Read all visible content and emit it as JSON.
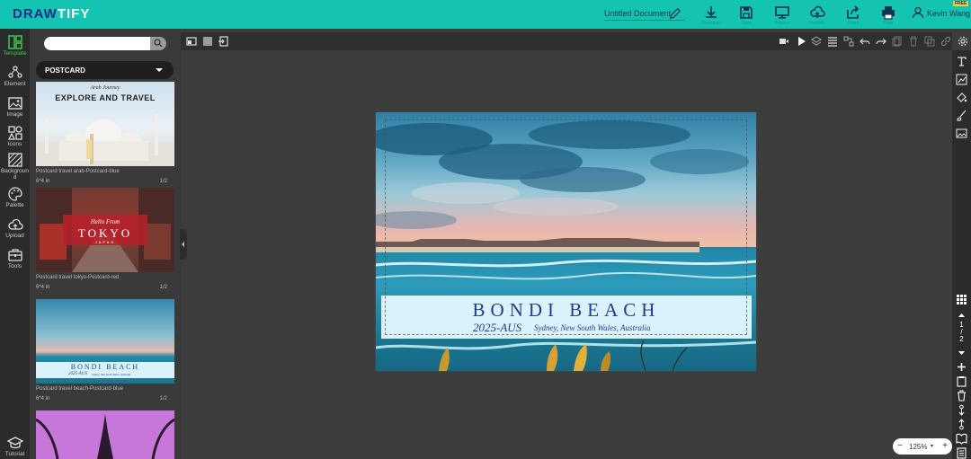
{
  "app": {
    "logo_main": "DRAW",
    "logo_accent": "TIFY",
    "document_title": "Untitled Document",
    "user_name": "Kevin Wang",
    "badge": "FREE"
  },
  "topbar": {
    "buttons": [
      {
        "name": "download",
        "label": "Download"
      },
      {
        "name": "save",
        "label": "Save"
      },
      {
        "name": "present",
        "label": "Present"
      },
      {
        "name": "publish",
        "label": "Publish"
      },
      {
        "name": "share",
        "label": "Share"
      },
      {
        "name": "print",
        "label": "Print"
      }
    ]
  },
  "rail": {
    "items": [
      {
        "name": "template",
        "label": "Template",
        "icon": "template-icon"
      },
      {
        "name": "element",
        "label": "Element",
        "icon": "element-icon"
      },
      {
        "name": "image",
        "label": "Image",
        "icon": "image-icon"
      },
      {
        "name": "icons",
        "label": "Icons",
        "icon": "shapes-icon"
      },
      {
        "name": "background",
        "label": "Backgroun d",
        "icon": "background-icon"
      },
      {
        "name": "palette",
        "label": "Palette",
        "icon": "palette-icon"
      },
      {
        "name": "upload",
        "label": "Upload",
        "icon": "cloud-upload-icon"
      },
      {
        "name": "tools",
        "label": "Tools",
        "icon": "toolbox-icon"
      },
      {
        "name": "tutorial",
        "label": "Tutorial",
        "icon": "graduation-cap-icon"
      }
    ]
  },
  "panel": {
    "search_placeholder": "",
    "category": "POSTCARD",
    "templates": [
      {
        "name": "Postcard travel arab-Postcard-blue",
        "size": "6*4 in",
        "pages": "1/2",
        "text1": "Arab Journey",
        "text2": "EXPLORE AND TRAVEL"
      },
      {
        "name": "Postcard travel tokyo-Postcard-red",
        "size": "6*4 in",
        "pages": "1/2",
        "text1": "Hello From",
        "text2": "TOKYO",
        "text3": "JAPAN"
      },
      {
        "name": "Postcard travel beach-Postcard-blue",
        "size": "6*4 in",
        "pages": "1/2",
        "text1": "BONDI BEACH",
        "text2": "2025-AUS",
        "text3": "Sydney, New South Wales, Australia"
      }
    ]
  },
  "postcard": {
    "title": "BONDI BEACH",
    "subtitle": "2025-AUS",
    "location": "Sydney, New South Wales, Australia"
  },
  "pager": {
    "current": "1",
    "separator": "/",
    "total": "2"
  },
  "zoom": {
    "level": "125%",
    "minus": "−",
    "plus": "+"
  },
  "colors": {
    "brand": "#14c3b1",
    "logo": "#1d2f8a",
    "accent_active": "#3ec84f",
    "title_text": "#1e3d8c"
  }
}
